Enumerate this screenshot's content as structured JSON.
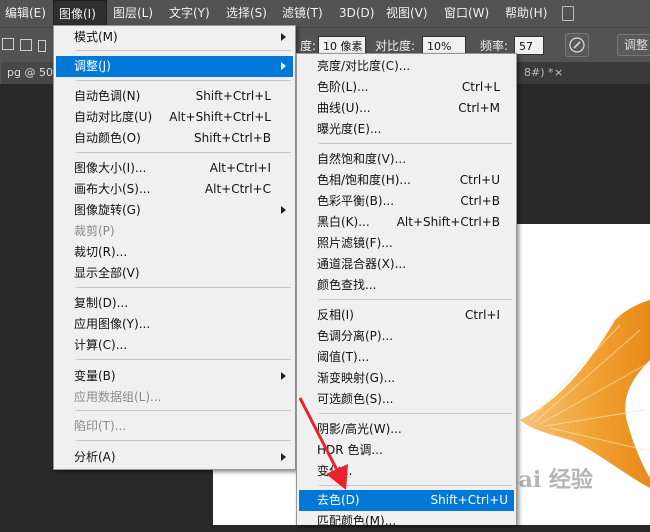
{
  "menubar": [
    {
      "label": "编辑(E)"
    },
    {
      "label": "图像(I)"
    },
    {
      "label": "图层(L)"
    },
    {
      "label": "文字(Y)"
    },
    {
      "label": "选择(S)"
    },
    {
      "label": "滤镜(T)"
    },
    {
      "label": "3D(D)"
    },
    {
      "label": "视图(V)"
    },
    {
      "label": "窗口(W)"
    },
    {
      "label": "帮助(H)"
    }
  ],
  "options": {
    "width_label": "度:",
    "width_value": "10 像素",
    "contrast_label": "对比度:",
    "contrast_value": "10%",
    "frequency_label": "频率:",
    "frequency_value": "57",
    "button_label": "调整"
  },
  "tabs": {
    "left": "pg @ 50%",
    "right": "8#) *",
    "close_glyph": "×"
  },
  "image_menu": {
    "items": [
      {
        "label": "模式(M)",
        "shortcut": "",
        "submenu": true,
        "disabled": false
      },
      {
        "label": "调整(J)",
        "shortcut": "",
        "submenu": true,
        "disabled": false,
        "highlighted": true
      },
      {
        "label": "自动色调(N)",
        "shortcut": "Shift+Ctrl+L",
        "submenu": false,
        "disabled": false
      },
      {
        "label": "自动对比度(U)",
        "shortcut": "Alt+Shift+Ctrl+L",
        "submenu": false,
        "disabled": false
      },
      {
        "label": "自动颜色(O)",
        "shortcut": "Shift+Ctrl+B",
        "submenu": false,
        "disabled": false
      },
      {
        "label": "图像大小(I)...",
        "shortcut": "Alt+Ctrl+I",
        "submenu": false,
        "disabled": false
      },
      {
        "label": "画布大小(S)...",
        "shortcut": "Alt+Ctrl+C",
        "submenu": false,
        "disabled": false
      },
      {
        "label": "图像旋转(G)",
        "shortcut": "",
        "submenu": true,
        "disabled": false
      },
      {
        "label": "裁剪(P)",
        "shortcut": "",
        "submenu": false,
        "disabled": true
      },
      {
        "label": "裁切(R)...",
        "shortcut": "",
        "submenu": false,
        "disabled": false
      },
      {
        "label": "显示全部(V)",
        "shortcut": "",
        "submenu": false,
        "disabled": false
      },
      {
        "label": "复制(D)...",
        "shortcut": "",
        "submenu": false,
        "disabled": false
      },
      {
        "label": "应用图像(Y)...",
        "shortcut": "",
        "submenu": false,
        "disabled": false
      },
      {
        "label": "计算(C)...",
        "shortcut": "",
        "submenu": false,
        "disabled": false
      },
      {
        "label": "变量(B)",
        "shortcut": "",
        "submenu": true,
        "disabled": false
      },
      {
        "label": "应用数据组(L)...",
        "shortcut": "",
        "submenu": false,
        "disabled": true
      },
      {
        "label": "陷印(T)...",
        "shortcut": "",
        "submenu": false,
        "disabled": true
      },
      {
        "label": "分析(A)",
        "shortcut": "",
        "submenu": true,
        "disabled": false
      }
    ]
  },
  "adjust_menu": {
    "items": [
      {
        "label": "亮度/对比度(C)...",
        "shortcut": ""
      },
      {
        "label": "色阶(L)...",
        "shortcut": "Ctrl+L"
      },
      {
        "label": "曲线(U)...",
        "shortcut": "Ctrl+M"
      },
      {
        "label": "曝光度(E)...",
        "shortcut": ""
      },
      {
        "label": "自然饱和度(V)...",
        "shortcut": ""
      },
      {
        "label": "色相/饱和度(H)...",
        "shortcut": "Ctrl+U"
      },
      {
        "label": "色彩平衡(B)...",
        "shortcut": "Ctrl+B"
      },
      {
        "label": "黑白(K)...",
        "shortcut": "Alt+Shift+Ctrl+B"
      },
      {
        "label": "照片滤镜(F)...",
        "shortcut": ""
      },
      {
        "label": "通道混合器(X)...",
        "shortcut": ""
      },
      {
        "label": "颜色查找...",
        "shortcut": ""
      },
      {
        "label": "反相(I)",
        "shortcut": "Ctrl+I"
      },
      {
        "label": "色调分离(P)...",
        "shortcut": ""
      },
      {
        "label": "阈值(T)...",
        "shortcut": ""
      },
      {
        "label": "渐变映射(G)...",
        "shortcut": ""
      },
      {
        "label": "可选颜色(S)...",
        "shortcut": ""
      },
      {
        "label": "阴影/高光(W)...",
        "shortcut": ""
      },
      {
        "label": "HDR 色调...",
        "shortcut": ""
      },
      {
        "label": "变化...",
        "shortcut": ""
      },
      {
        "label": "去色(D)",
        "shortcut": "Shift+Ctrl+U",
        "highlighted": true
      },
      {
        "label": "匹配颜色(M)...",
        "shortcut": ""
      }
    ]
  },
  "watermark": "Bai 经验",
  "colors": {
    "highlight": "#0078d7",
    "annotation_arrow": "#e8232a",
    "fish_tail": "#f0a030"
  }
}
